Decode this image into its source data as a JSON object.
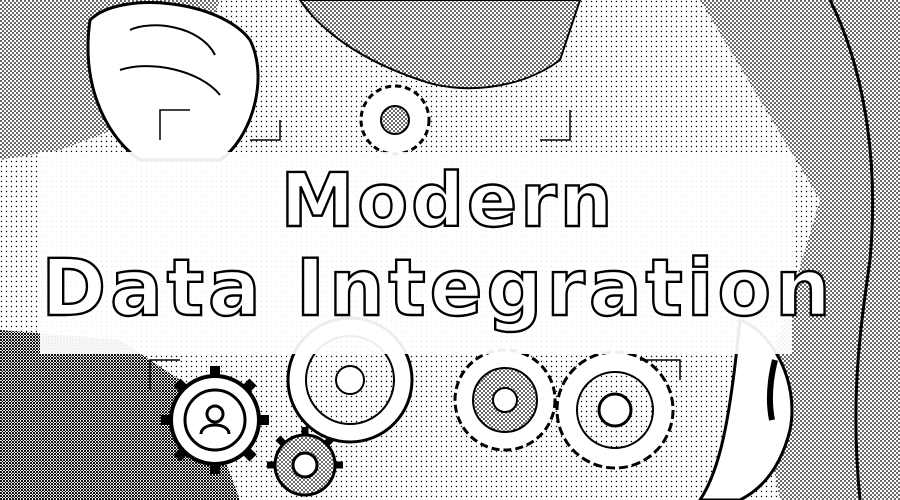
{
  "headline": {
    "line1": "Modern",
    "line2": "Data Integration"
  },
  "palette": {
    "ink": "#000000",
    "paper": "#ffffff",
    "halftone": "#1a1a1a"
  },
  "illustration": {
    "description_icons": [
      "hand-icon",
      "gear-icon",
      "user-gear-icon",
      "gear-cluster-icon"
    ]
  }
}
